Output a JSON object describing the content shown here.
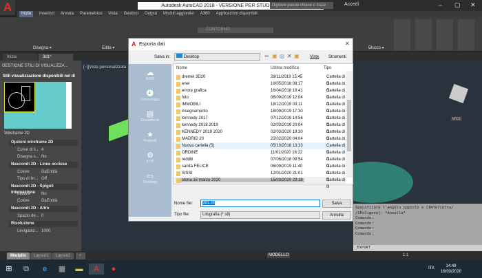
{
  "app": {
    "title": "Autodesk AutoCAD 2018 - VERSIONE PER STUDENTI    3d1.dwg",
    "search_placeholder": "Digitare parola chiave o frase",
    "signin": "Accedi"
  },
  "ribbon": {
    "tabs": [
      "Inizio",
      "Inserisci",
      "Annota",
      "Parametrico",
      "Vista",
      "Gestisci",
      "Output",
      "Moduli aggiuntivi",
      "A360",
      "Applicazioni disponibili"
    ],
    "active_tab": "Inizio",
    "groups": [
      "Disegna ▾",
      "Edita ▾",
      "Blocco ▾"
    ],
    "layer": "CONTORNO"
  },
  "doc_tabs": [
    "Inizia",
    "3d1*"
  ],
  "palette": {
    "header": "GESTIONE STILI DI VISUALIZZA...",
    "subtitle": "Stili visualizzazione disponibili nel di",
    "selected_style": "Wireframe 2D",
    "sections": [
      {
        "title": "Opzioni wireframe 2D",
        "rows": [
          [
            "Curve di li...",
            "4"
          ],
          [
            "Disegna s...",
            "No"
          ]
        ]
      },
      {
        "title": "Nascondi 2D - Linee occluse",
        "rows": [
          [
            "Colore",
            "DaEntità"
          ],
          [
            "Tipo di lin...",
            "Off"
          ]
        ]
      },
      {
        "title": "Nascondi 2D - Spigoli intersezione",
        "rows": [
          [
            "Mostra",
            "No"
          ],
          [
            "Colore",
            "DaEntità"
          ]
        ]
      },
      {
        "title": "Nascondi 2D - Altro",
        "rows": [
          [
            "Spazio de...",
            "0"
          ]
        ]
      },
      {
        "title": "Risoluzione",
        "rows": [
          [
            "Levigatez...",
            "1000"
          ]
        ]
      }
    ]
  },
  "viewport": {
    "label": "[−][Vista personalizzata",
    "viewcube": "WCS"
  },
  "command": {
    "history": "Specificare l'angolo opposto o [INTercetta/\n/IPoligono]: *Annulla*\nComando:\nComando:\nComando:\nComando:",
    "input": "_EXPORT"
  },
  "layout_tabs": [
    "Modello",
    "Layout1",
    "Layout2",
    "+"
  ],
  "status": {
    "mode": "MODELLO",
    "scale": "1:1"
  },
  "taskbar": {
    "lang": "ITA",
    "time": "14:49",
    "date": "16/03/2020"
  },
  "dialog": {
    "title": "Esporta dati",
    "save_in_label": "Salva in:",
    "save_in": "Desktop",
    "views": "Viste",
    "tools": "Strumenti",
    "places": [
      "A360",
      "Cronologia",
      "Documenti",
      "Preferiti",
      "FTP",
      "Desktop"
    ],
    "columns": [
      "Nome",
      "Ultima modifica",
      "Tipo"
    ],
    "files": [
      [
        "dremel 3D20",
        "28/11/2019 15:45",
        "Cartella di fil"
      ],
      [
        "enel",
        "19/05/2018 08:17",
        "Cartella di fil"
      ],
      [
        "errore grafica",
        "16/04/2018 18:41",
        "Cartella di fil"
      ],
      [
        "foto",
        "06/09/2019 12:04",
        "Cartella di fil"
      ],
      [
        "IMMOBILI",
        "18/12/2019 03:11",
        "Cartella di fil"
      ],
      [
        "insegnamento",
        "18/09/2019 17:30",
        "Cartella di fil"
      ],
      [
        "kennedy 2017",
        "07/12/2019 14:56",
        "Cartella di fil"
      ],
      [
        "kennedy 2018 2019",
        "02/03/2019 20:04",
        "Cartella di fil"
      ],
      [
        "KENNEDY 2019 2020",
        "02/03/2020 19:30",
        "Cartella di fil"
      ],
      [
        "MADRID 20",
        "22/02/2020 04:04",
        "Cartella di fil"
      ],
      [
        "Nuova cartella (5)",
        "05/10/2018 13:33",
        "Cartella di fil"
      ],
      [
        "ORDINE",
        "11/02/2020 16:22",
        "Cartella di fil"
      ],
      [
        "redditi",
        "07/06/2018 09:54",
        "Cartella di fil"
      ],
      [
        "sanità FELICE",
        "06/09/2019 11:40",
        "Cartella di fil"
      ],
      [
        "SISSI",
        "12/01/2020 21:01",
        "Cartella di fil"
      ],
      [
        "storia 15 marzo 2020",
        "15/03/2020 23:18",
        "Cartella di fil"
      ]
    ],
    "hovered_index": 10,
    "filename_label": "Nome file:",
    "filename": "3d1.stl",
    "filetype_label": "Tipo file:",
    "filetype": "Litografia (*.stl)",
    "save": "Salva",
    "cancel": "Annulla"
  }
}
